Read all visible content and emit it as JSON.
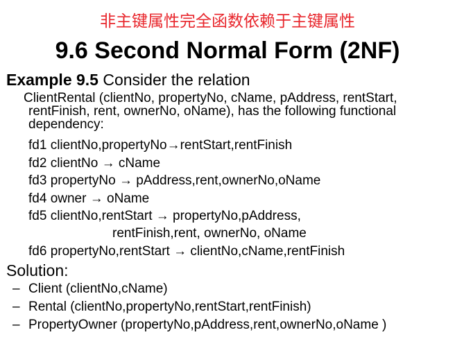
{
  "slide": {
    "chinese_title": "非主键属性完全函数依赖于主键属性",
    "title": "9.6 Second Normal Form (2NF)",
    "example_label": "Example 9.5",
    "example_text": " Consider the relation",
    "relation_lines": [
      "ClientRental (clientNo, propertyNo, cName, pAddress, rentStart,",
      "rentFinish, rent, ownerNo, oName), has the following functional",
      "dependency:"
    ],
    "fds": [
      "fd1 clientNo,propertyNo→rentStart,rentFinish",
      "fd2 clientNo → cName",
      "fd3 propertyNo → pAddress,rent,ownerNo,oName",
      "fd4 owner → oName",
      "fd5 clientNo,rentStart → propertyNo,pAddress,",
      "rentFinish,rent, ownerNo, oName",
      "fd6 propertyNo,rentStart → clientNo,cName,rentFinish"
    ],
    "solution_title": "Solution:",
    "solution_items": [
      "Client (clientNo,cName)",
      "Rental (clientNo,propertyNo,rentStart,rentFinish)",
      "PropertyOwner (propertyNo,pAddress,rent,ownerNo,oName )"
    ],
    "bullet": "–",
    "colors": {
      "chinese_title": "#e8262c",
      "text": "#000000",
      "background": "#ffffff"
    }
  }
}
